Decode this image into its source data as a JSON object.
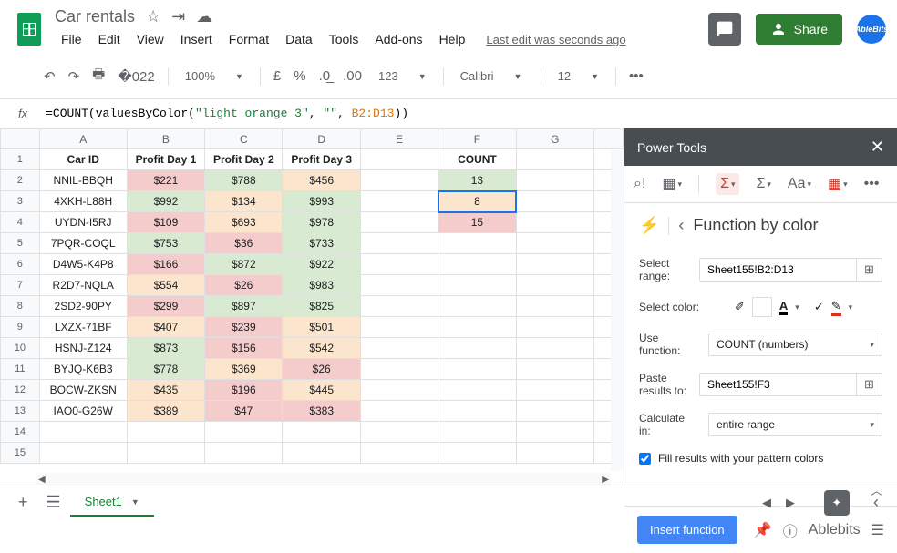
{
  "doc": {
    "title": "Car rentals"
  },
  "menu": [
    "File",
    "Edit",
    "View",
    "Insert",
    "Format",
    "Data",
    "Tools",
    "Add-ons",
    "Help"
  ],
  "last_edit": "Last edit was seconds ago",
  "share": "Share",
  "avatar": "AbleBits",
  "toolbar": {
    "zoom": "100%",
    "currency_sym": "£",
    "percent": "%",
    "more_formats": "123",
    "font": "Calibri",
    "font_size": "12"
  },
  "formula": {
    "prefix": "=COUNT(valuesByColor(",
    "str1": "\"light orange 3\"",
    "sep1": ", ",
    "str2": "\"\"",
    "sep2": ", ",
    "range": "B2:D13",
    "suffix": "))"
  },
  "cols": [
    "A",
    "B",
    "C",
    "D",
    "E",
    "F",
    "G"
  ],
  "headers": {
    "a": "Car ID",
    "b": "Profit Day 1",
    "c": "Profit Day 2",
    "d": "Profit Day 3",
    "f": "COUNT"
  },
  "rows": [
    {
      "id": "NNIL-BBQH",
      "d1": {
        "v": "$221",
        "c": "red"
      },
      "d2": {
        "v": "$788",
        "c": "green"
      },
      "d3": {
        "v": "$456",
        "c": "orange"
      },
      "cnt": {
        "v": "13",
        "c": "green"
      }
    },
    {
      "id": "4XKH-L88H",
      "d1": {
        "v": "$992",
        "c": "green"
      },
      "d2": {
        "v": "$134",
        "c": "orange"
      },
      "d3": {
        "v": "$993",
        "c": "green"
      },
      "cnt": {
        "v": "8",
        "c": "orange"
      }
    },
    {
      "id": "UYDN-I5RJ",
      "d1": {
        "v": "$109",
        "c": "red"
      },
      "d2": {
        "v": "$693",
        "c": "orange"
      },
      "d3": {
        "v": "$978",
        "c": "green"
      },
      "cnt": {
        "v": "15",
        "c": "red"
      }
    },
    {
      "id": "7PQR-COQL",
      "d1": {
        "v": "$753",
        "c": "green"
      },
      "d2": {
        "v": "$36",
        "c": "red"
      },
      "d3": {
        "v": "$733",
        "c": "green"
      }
    },
    {
      "id": "D4W5-K4P8",
      "d1": {
        "v": "$166",
        "c": "red"
      },
      "d2": {
        "v": "$872",
        "c": "green"
      },
      "d3": {
        "v": "$922",
        "c": "green"
      }
    },
    {
      "id": "R2D7-NQLA",
      "d1": {
        "v": "$554",
        "c": "orange"
      },
      "d2": {
        "v": "$26",
        "c": "red"
      },
      "d3": {
        "v": "$983",
        "c": "green"
      }
    },
    {
      "id": "2SD2-90PY",
      "d1": {
        "v": "$299",
        "c": "red"
      },
      "d2": {
        "v": "$897",
        "c": "green"
      },
      "d3": {
        "v": "$825",
        "c": "green"
      }
    },
    {
      "id": "LXZX-71BF",
      "d1": {
        "v": "$407",
        "c": "orange"
      },
      "d2": {
        "v": "$239",
        "c": "red"
      },
      "d3": {
        "v": "$501",
        "c": "orange"
      }
    },
    {
      "id": "HSNJ-Z124",
      "d1": {
        "v": "$873",
        "c": "green"
      },
      "d2": {
        "v": "$156",
        "c": "red"
      },
      "d3": {
        "v": "$542",
        "c": "orange"
      }
    },
    {
      "id": "BYJQ-K6B3",
      "d1": {
        "v": "$778",
        "c": "green"
      },
      "d2": {
        "v": "$369",
        "c": "orange"
      },
      "d3": {
        "v": "$26",
        "c": "red"
      }
    },
    {
      "id": "BOCW-ZKSN",
      "d1": {
        "v": "$435",
        "c": "orange"
      },
      "d2": {
        "v": "$196",
        "c": "red"
      },
      "d3": {
        "v": "$445",
        "c": "orange"
      }
    },
    {
      "id": "IAO0-G26W",
      "d1": {
        "v": "$389",
        "c": "orange"
      },
      "d2": {
        "v": "$47",
        "c": "red"
      },
      "d3": {
        "v": "$383",
        "c": "red"
      }
    }
  ],
  "panel": {
    "title": "Power Tools",
    "page_title": "Function by color",
    "labels": {
      "range": "Select range:",
      "color": "Select color:",
      "func": "Use function:",
      "paste": "Paste results to:",
      "calc": "Calculate in:",
      "fill": "Fill results with your pattern colors"
    },
    "values": {
      "range": "Sheet155!B2:D13",
      "func": "COUNT (numbers)",
      "paste": "Sheet155!F3",
      "calc": "entire range"
    },
    "insert_btn": "Insert function",
    "brand": "Ablebits"
  },
  "sheet_tab": "Sheet1"
}
